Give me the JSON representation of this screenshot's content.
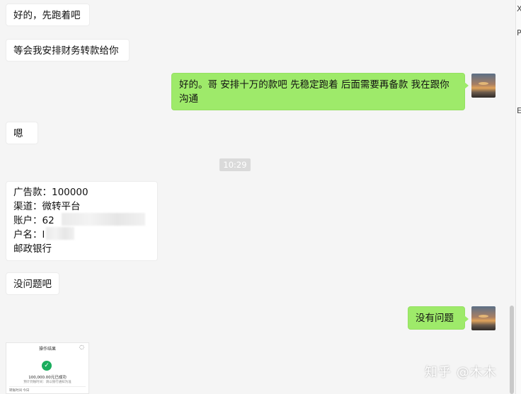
{
  "messages": {
    "m1": "好的，先跑着吧",
    "m2": "等会我安排财务转款给你",
    "m3": "好的。哥 安排十万的款吧 先稳定跑着 后面需要再备款 我在跟你沟通",
    "m4": "嗯",
    "timestamp": "10:29",
    "m5": {
      "line1": "广告款：100000",
      "line2": "渠道：微转平台",
      "line3_prefix": "账户：62",
      "line3_suffix": "51",
      "line4_prefix": "户名：",
      "line4_visible": "l",
      "line5": "邮政银行"
    },
    "m6": "没问题吧",
    "m7": "没有问题"
  },
  "thumbnail": {
    "title": "操作结果",
    "close": "◌",
    "check": "✓",
    "amount": "100,000.00元已成功",
    "sub": "预计到账时间：请以银行通知为准",
    "foot": "转账时间      今日"
  },
  "right_panel": {
    "tick1": "X",
    "tick2": "P",
    "tick3": "E"
  },
  "watermark": "知乎 @木木",
  "colors": {
    "background": "#f5f5f5",
    "incoming_bubble": "#ffffff",
    "outgoing_bubble": "#9eea6a",
    "timestamp_bg": "#dadada"
  }
}
